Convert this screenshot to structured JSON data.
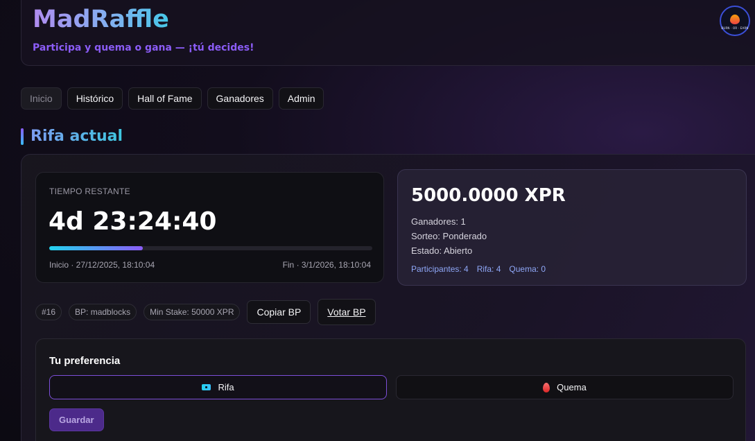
{
  "header": {
    "title": "MadRaffle",
    "subtitle": "Participa y quema o gana — ¡tú decides!",
    "logo_text": "BURN · OR · EARN"
  },
  "nav": {
    "items": [
      "Inicio",
      "Histórico",
      "Hall of Fame",
      "Ganadores",
      "Admin"
    ],
    "active": "Inicio"
  },
  "section_title": "Rifa actual",
  "timer": {
    "label": "TIEMPO RESTANTE",
    "value": "4d 23:24:40",
    "progress_fraction": 0.29,
    "start": "Inicio · 27/12/2025, 18:10:04",
    "end": "Fin · 3/1/2026, 18:10:04"
  },
  "prize": {
    "amount": "5000.0000 XPR",
    "winners": "Ganadores: 1",
    "draw": "Sorteo: Ponderado",
    "status": "Estado: Abierto",
    "participants": "Participantes: 4",
    "raffle": "Rifa: 4",
    "burn": "Quema: 0"
  },
  "chips": {
    "id": "#16",
    "bp": "BP: madblocks",
    "min_stake": "Min Stake: 50000 XPR",
    "copy_bp": "Copiar BP",
    "vote_bp": "Votar BP"
  },
  "preference": {
    "title": "Tu preferencia",
    "option_raffle": "Rifa",
    "option_burn": "Quema",
    "selected": "Rifa",
    "save": "Guardar"
  },
  "icons": {
    "logo": "flame-logo-icon",
    "raffle": "ticket-icon",
    "burn": "fire-icon"
  },
  "colors": {
    "accent": "#8b5cf6",
    "cyan": "#22d3ee",
    "background": "#0c0a12"
  }
}
